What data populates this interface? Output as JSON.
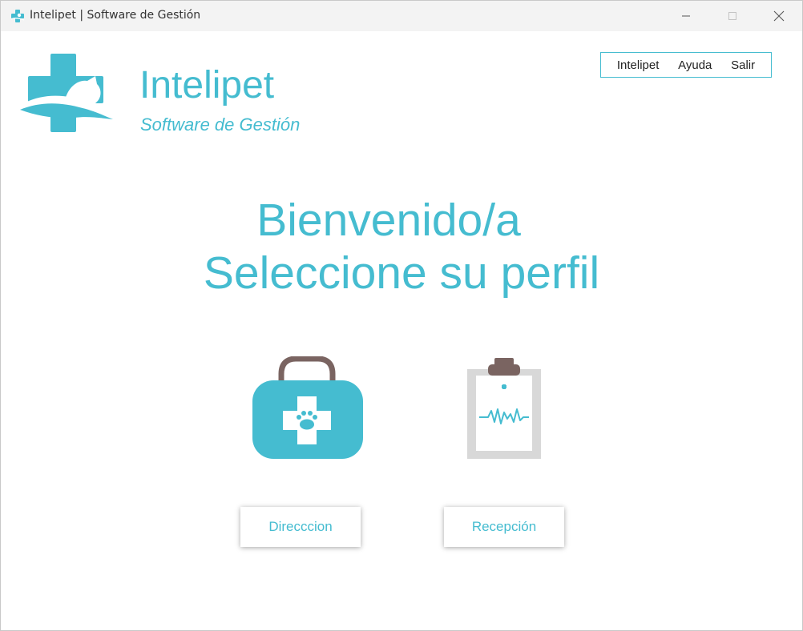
{
  "window": {
    "title": "Intelipet | Software de Gestión"
  },
  "brand": {
    "name": "Intelipet",
    "subtitle": "Software de Gestión",
    "color": "#45bcd0"
  },
  "menu": {
    "items": [
      "Intelipet",
      "Ayuda",
      "Salir"
    ]
  },
  "welcome": {
    "line1": "Bienvenido/a",
    "line2": "Seleccione su perfil"
  },
  "profiles": [
    {
      "label": "Direcccion",
      "icon": "medkit-paw-icon"
    },
    {
      "label": "Recepción",
      "icon": "clipboard-heartbeat-icon"
    }
  ],
  "colors": {
    "accent": "#45bcd0",
    "handle": "#7a6461",
    "clipboard_gray": "#d8d8d8"
  }
}
